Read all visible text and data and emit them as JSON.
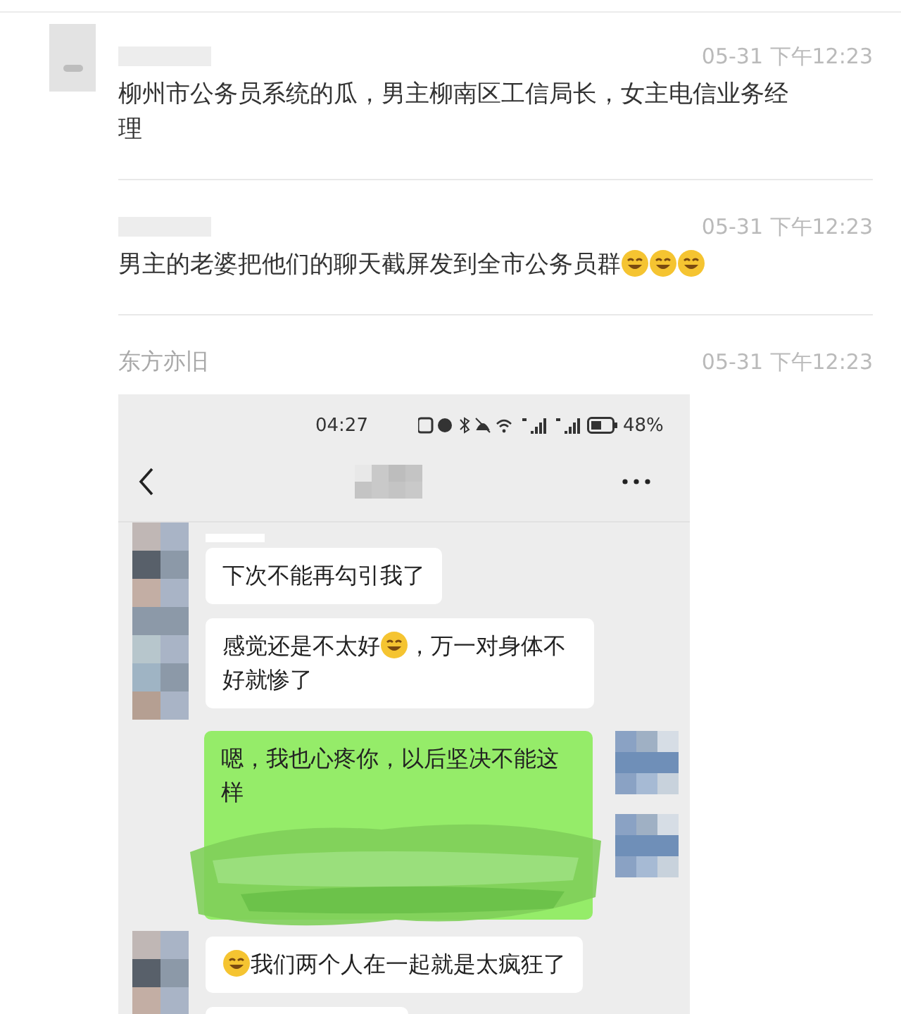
{
  "comments": [
    {
      "avatar": true,
      "time": "05-31 下午12:23",
      "parts": [
        {
          "kind": "text",
          "text": "柳州市公务员系统的瓜，男主柳南区工信局长，女主电信业务经理"
        }
      ]
    },
    {
      "avatar": false,
      "time": "05-31 下午12:23",
      "parts": [
        {
          "kind": "text",
          "text": "男主的老婆把他们的聊天截屏发到全市公务员群"
        },
        {
          "kind": "emoji"
        },
        {
          "kind": "emoji"
        },
        {
          "kind": "emoji"
        }
      ]
    },
    {
      "avatar": false,
      "author": "东方亦旧",
      "time": "05-31 下午12:23"
    }
  ],
  "chat_screenshot": {
    "status_bar": {
      "time": "04:27",
      "battery": "48%"
    },
    "messages": [
      {
        "kind": "received",
        "parts": [
          {
            "kind": "text",
            "text": "下次不能再勾引我了"
          }
        ]
      },
      {
        "kind": "received",
        "parts": [
          {
            "kind": "text",
            "text": "感觉还是不太好"
          },
          {
            "kind": "emoji"
          },
          {
            "kind": "text",
            "text": "，万一对身体不好就惨了"
          }
        ]
      },
      {
        "kind": "sent",
        "smudged": true,
        "parts": [
          {
            "kind": "text",
            "text": "嗯，我也心疼你，以后坚决不能这样"
          }
        ]
      },
      {
        "kind": "received",
        "parts": [
          {
            "kind": "emoji"
          },
          {
            "kind": "text",
            "text": "我们两个人在一起就是太疯狂了"
          }
        ]
      },
      {
        "kind": "received",
        "obscured": true
      }
    ]
  }
}
